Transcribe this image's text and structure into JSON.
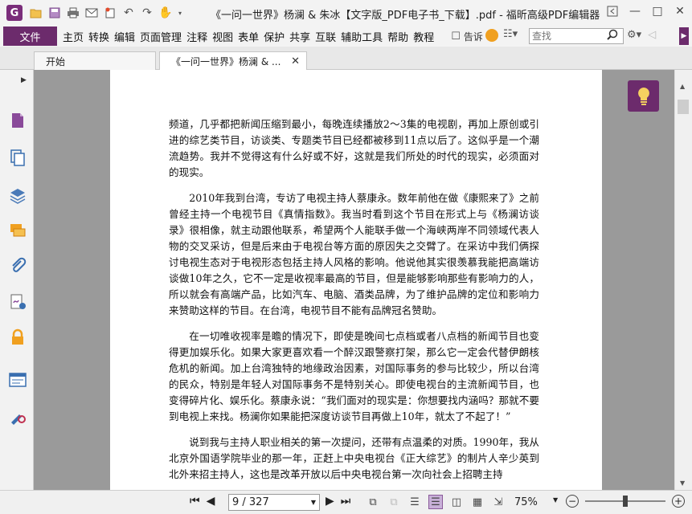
{
  "window": {
    "title": "《一问一世界》杨澜 & 朱冰【文字版_PDF电子书_下载】.pdf - 福昕高级PDF编辑器",
    "quick_access_icons": [
      "open-folder-icon",
      "save-icon",
      "print-icon",
      "mail-icon",
      "new-icon",
      "undo-icon",
      "redo-icon",
      "hand-tool-icon"
    ],
    "controls": [
      "restore-icon",
      "minimize-icon",
      "maximize-icon",
      "close-icon"
    ]
  },
  "menu": {
    "file_label": "文件",
    "items": [
      "主页",
      "转换",
      "编辑",
      "页面管理",
      "注释",
      "视图",
      "表单",
      "保护",
      "共享",
      "互联",
      "辅助工具",
      "帮助",
      "教程"
    ],
    "tell_me": "告诉",
    "search_placeholder": "查找"
  },
  "tabs": [
    {
      "label": "开始"
    },
    {
      "label": "《一问一世界》杨澜 & ..."
    }
  ],
  "sidebar": {
    "icons": [
      "pages-thumbnail-icon",
      "copy-pages-icon",
      "layers-icon",
      "comments-icon",
      "attachment-icon",
      "signature-icon",
      "lock-icon",
      "form-fields-icon",
      "certify-icon"
    ]
  },
  "document": {
    "paragraphs": [
      "频道，几乎都把新闻压缩到最小，每晚连续播放2～3集的电视剧，再加上原创或引进的综艺类节目，访谈类、专题类节目已经都被移到11点以后了。这似乎是一个潮流趋势。我并不觉得这有什么好或不好，这就是我们所处的时代的现实，必须面对的现实。",
      "2010年我到台湾，专访了电视主持人蔡康永。数年前他在做《康熙来了》之前曾经主持一个电视节目《真情指数》。我当时看到这个节目在形式上与《杨澜访谈录》很相像，就主动跟他联系，希望两个人能联手做一个海峡两岸不同领域代表人物的交叉采访，但是后来由于电视台等方面的原因失之交臂了。在采访中我们俩探讨电视生态对于电视形态包括主持人风格的影响。他说他其实很羡慕我能把高端访谈做10年之久，它不一定是收视率最高的节目，但是能够影响那些有影响力的人，所以就会有高端产品，比如汽车、电脑、酒类品牌，为了维护品牌的定位和影响力来赞助这样的节目。在台湾，电视节目不能有品牌冠名赞助。",
      "在一切唯收视率是瞻的情况下，即使是晚间七点档或者八点档的新闻节目也变得更加娱乐化。如果大家更喜欢看一个醉汉跟警察打架，那么它一定会代替伊朗核危机的新闻。加上台湾独特的地缘政治因素，对国际事务的参与比较少，所以台湾的民众，特别是年轻人对国际事务不是特别关心。即使电视台的主流新闻节目，也变得碎片化、娱乐化。蔡康永说：“我们面对的现实是：你想要找内涵吗？那就不要到电视上来找。杨澜你如果能把深度访谈节目再做上10年，就太了不起了！”",
      "说到我与主持人职业相关的第一次提问，还带有点温柔的对质。1990年，我从北京外国语学院毕业的那一年，正赶上中央电视台《正大综艺》的制片人辛少英到北外来招主持人，这也是改革开放以后中央电视台第一次向社会上招聘主持"
    ]
  },
  "status": {
    "page_display": "9 / 327",
    "zoom": "75%",
    "zoom_fraction": 0.5
  }
}
